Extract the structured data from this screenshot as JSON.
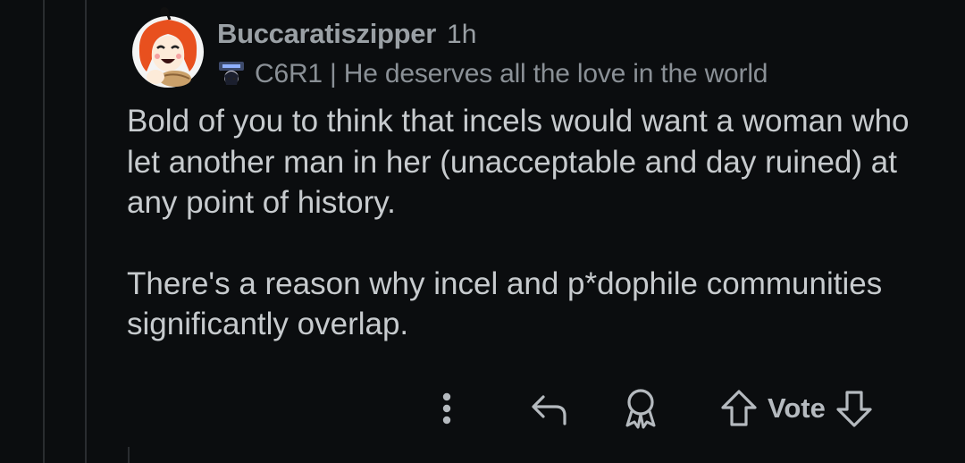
{
  "comment": {
    "username": "Buccaratiszipper",
    "time": "1h",
    "flair": {
      "icon": "character-flair-icon",
      "text": "C6R1 | He deserves all the love in the world"
    },
    "paragraphs": [
      "Bold of you to think that incels would want a woman who let another man in her (unacceptable and day ruined) at any point of history.",
      "There's a reason why incel and p*dophile communities significantly overlap."
    ]
  },
  "actions": {
    "more_icon": "vertical-dots-icon",
    "reply_icon": "reply-arrow-icon",
    "award_icon": "award-icon",
    "upvote_icon": "upvote-arrow-icon",
    "vote_label": "Vote",
    "downvote_icon": "downvote-arrow-icon"
  },
  "colors": {
    "background": "#0b0d0f",
    "text": "#c7cbce",
    "meta": "#9aa0a5",
    "avatar_hair": "#e8501e"
  }
}
